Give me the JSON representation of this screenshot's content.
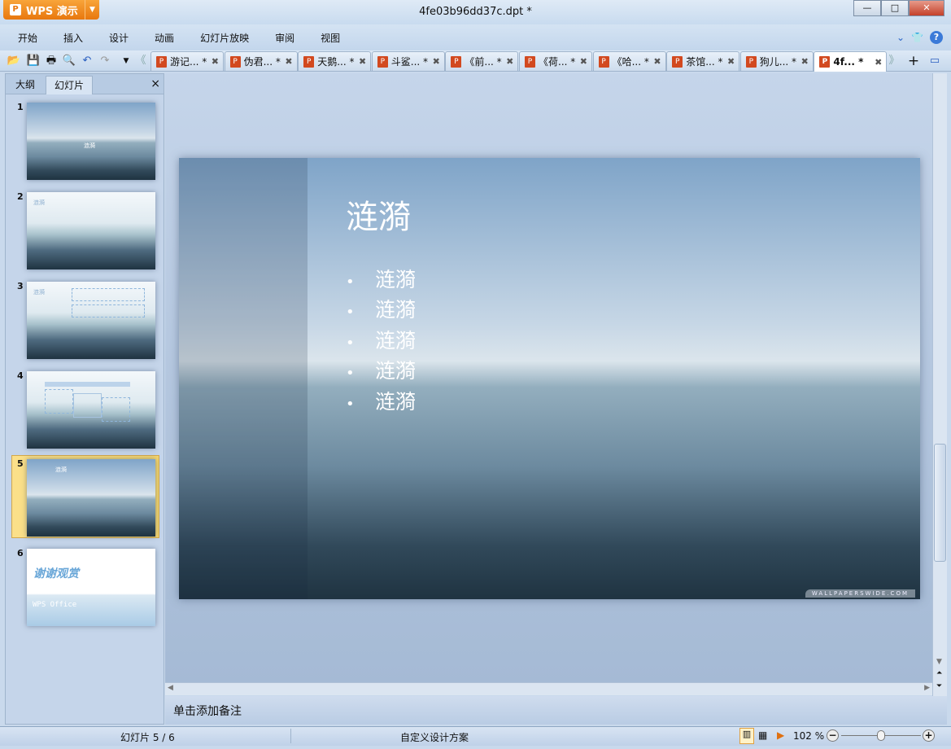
{
  "app": {
    "name": "WPS 演示",
    "doc_title": "4fe03b96dd37c.dpt *"
  },
  "window": {
    "minimize": "—",
    "maximize": "□",
    "close": "✕"
  },
  "menu": [
    "开始",
    "插入",
    "设计",
    "动画",
    "幻灯片放映",
    "审阅",
    "视图"
  ],
  "doc_tabs": [
    {
      "label": "游记... *"
    },
    {
      "label": "伪君... *"
    },
    {
      "label": "天鹅... *"
    },
    {
      "label": "斗鲨... *"
    },
    {
      "label": "《前... *"
    },
    {
      "label": "《荷... *"
    },
    {
      "label": "《哈... *"
    },
    {
      "label": "茶馆... *"
    },
    {
      "label": "狗儿... *"
    },
    {
      "label": "4f... *",
      "active": true
    }
  ],
  "panel": {
    "tabs": [
      "大纲",
      "幻灯片"
    ],
    "active_tab": "幻灯片",
    "close": "×",
    "slides": [
      {
        "num": "1",
        "title": "涟漪"
      },
      {
        "num": "2",
        "title": "涟漪"
      },
      {
        "num": "3",
        "title": "涟漪"
      },
      {
        "num": "4",
        "title": ""
      },
      {
        "num": "5",
        "title": "涟漪",
        "selected": true
      },
      {
        "num": "6",
        "title": "谢谢观赏",
        "subtitle": "WPS Office"
      }
    ]
  },
  "slide": {
    "title": "涟漪",
    "bullets": [
      "涟漪",
      "涟漪",
      "涟漪",
      "涟漪",
      "涟漪"
    ],
    "watermark": "WALLPAPERSWIDE.COM"
  },
  "notes": {
    "placeholder": "单击添加备注"
  },
  "status": {
    "slide_indicator": "幻灯片 5 / 6",
    "design": "自定义设计方案",
    "zoom": "102 %",
    "zoom_level": 0.5
  }
}
